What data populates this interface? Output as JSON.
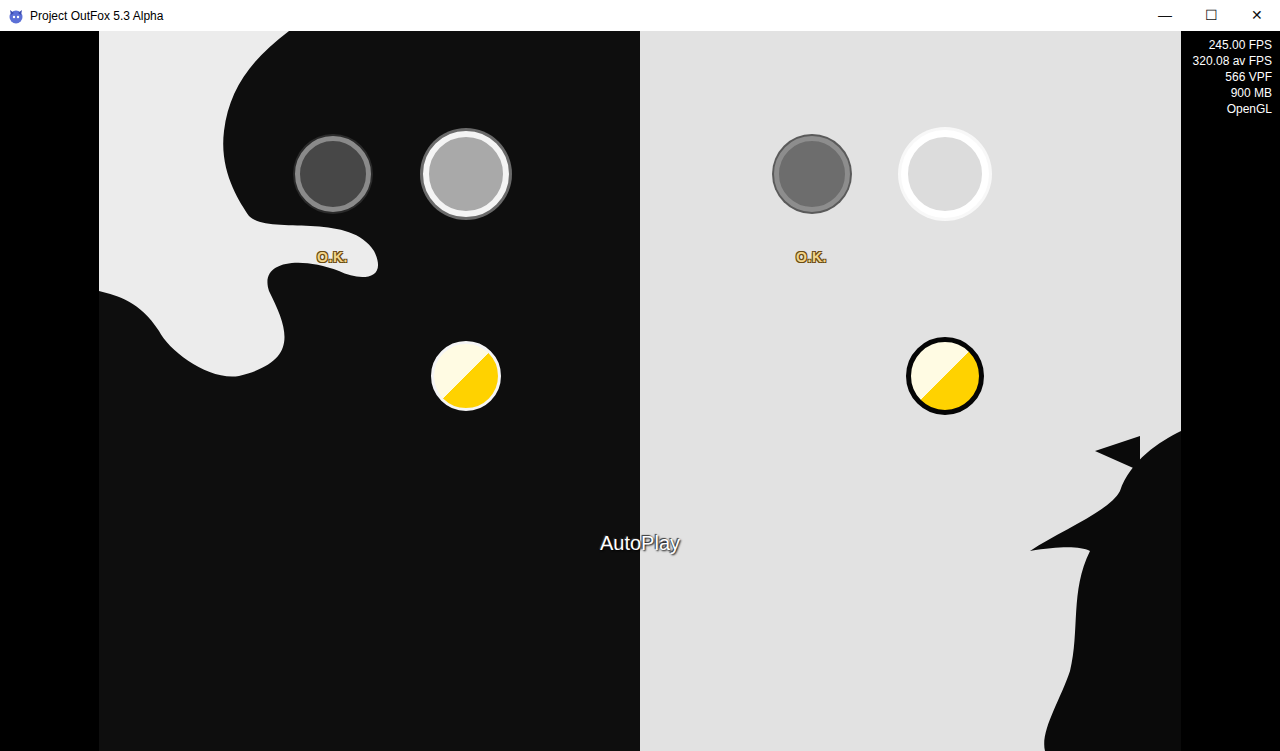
{
  "window": {
    "title": "Project OutFox 5.3 Alpha",
    "controls": [
      "—",
      "☐",
      "✕"
    ]
  },
  "stats": [
    "245.00 FPS",
    "320.08 av FPS",
    "566 VPF",
    "900 MB",
    "OpenGL"
  ],
  "players": [
    {
      "kind": "dark",
      "receptors": [
        {
          "pressed": false,
          "note": false,
          "judgment": "O.K."
        },
        {
          "pressed": true,
          "note": true
        }
      ]
    },
    {
      "kind": "light",
      "receptors": [
        {
          "pressed": false,
          "note": false,
          "judgment": "O.K."
        },
        {
          "pressed": true,
          "note": true
        }
      ]
    }
  ],
  "autoplay": "AutoPlay"
}
